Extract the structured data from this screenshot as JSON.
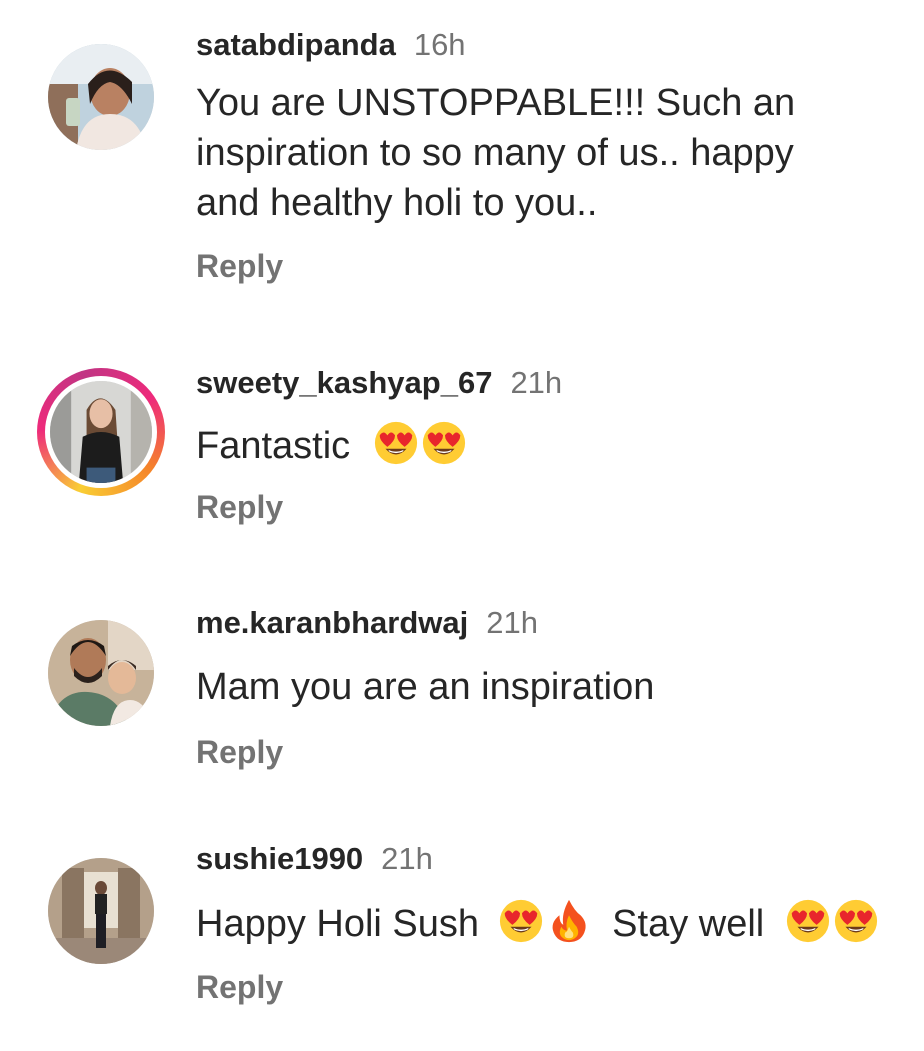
{
  "comments": [
    {
      "username": "satabdipanda",
      "time": "16h",
      "text_lines": [
        "You are UNSTOPPABLE!!! Such an",
        "inspiration to so many of us.. happy",
        "and healthy holi to you.."
      ],
      "reply_label": "Reply",
      "has_story_ring": false
    },
    {
      "username": "sweety_kashyap_67",
      "time": "21h",
      "text": "Fantastic",
      "emojis": [
        "heart-eyes-emoji",
        "heart-eyes-emoji"
      ],
      "reply_label": "Reply",
      "has_story_ring": true
    },
    {
      "username": "me.karanbhardwaj",
      "time": "21h",
      "text": "Mam you are an inspiration",
      "reply_label": "Reply",
      "has_story_ring": false
    },
    {
      "username": "sushie1990",
      "time": "21h",
      "text_part1": "Happy Holi Sush",
      "emojis_part1": [
        "heart-eyes-emoji",
        "fire-emoji"
      ],
      "text_part2": "Stay well",
      "emojis_part2": [
        "heart-eyes-emoji",
        "heart-eyes-emoji"
      ],
      "reply_label": "Reply",
      "has_story_ring": false
    }
  ],
  "colors": {
    "username": "#262626",
    "secondary": "#737373",
    "story_ring": [
      "#f9ce34",
      "#ee2a7b",
      "#f58529"
    ]
  }
}
